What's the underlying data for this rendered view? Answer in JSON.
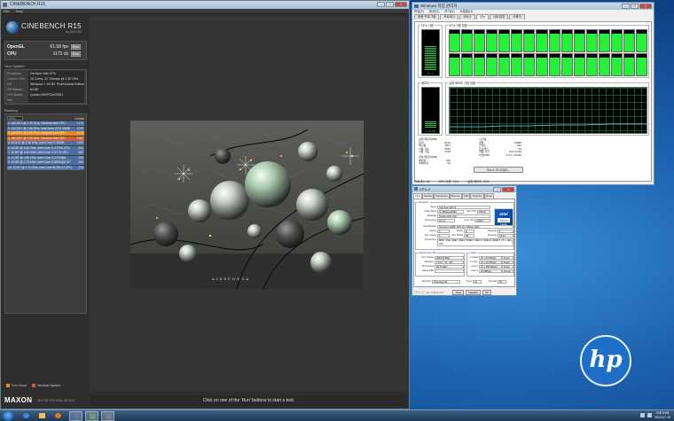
{
  "cinebench": {
    "window_title": "CINEBENCH R15",
    "menu": [
      "File",
      "Help"
    ],
    "app_name": "CINEBENCH R15",
    "app_sub": "by MAXON",
    "results": [
      {
        "label": "OpenGL",
        "value": "61.58 fps",
        "button": "Run"
      },
      {
        "label": "CPU",
        "value": "1173 cb",
        "button": "Run"
      }
    ],
    "system_heading": "Your System",
    "system": [
      {
        "k": "Processor",
        "v": "Genuine Intel CPU"
      },
      {
        "k": "Cores x GHz",
        "v": "16 Cores, 32 Threads @ 2.30 GHz"
      },
      {
        "k": "OS",
        "v": "Windows 7, 64 Bit, Professional Edition"
      },
      {
        "k": "CB Version",
        "v": "64 Bit"
      },
      {
        "k": "GFX Board",
        "v": "Quadro 600/PCIe/SSE2"
      },
      {
        "k": "Info",
        "v": ""
      }
    ],
    "ranking_heading": "Ranking",
    "ranking_select": "CPU",
    "ranking_details": "Details",
    "ranking": [
      {
        "t": "1. 16C/32T @ 2.30 GHz, Genuine Intel CPU",
        "s": "1173",
        "c": "#4c6f9f"
      },
      {
        "t": "2. 12C/24T @ 2.66 GHz, Intel Xeon CPU X5650",
        "s": "1279",
        "c": "#4c6f9f"
      },
      {
        "t": "3. 16C/32T @ 2.30 GHz, Genuine Intel CPU",
        "s": "1173",
        "c": "#e58a1e"
      },
      {
        "t": "4. 16C/32T @ 2.30 GHz, Genuine Intel CPU",
        "s": "1084",
        "c": "#c9632f"
      },
      {
        "t": "5. 6C/12T @ 3.30 GHz, Intel Core i7-3930K",
        "s": "1005",
        "c": "#4c6f9f"
      },
      {
        "t": "6. 4C/8T @ 4.40 GHz, Intel Core i7-4770K CPU",
        "s": "822",
        "c": "#4c6f9f"
      },
      {
        "t": "7. 4C/8T @ 3.40 GHz, Intel Core i7-3770 CPU",
        "s": "662",
        "c": "#4c6f9f"
      },
      {
        "t": "8. 4C/8T @ 2.60 GHz, Intel Core i7-3720QM",
        "s": "590",
        "c": "#4c6f9f"
      },
      {
        "t": "9. 4C/8T @ 2.79 GHz, Intel Core i7-3840QM CP",
        "s": "505",
        "c": "#4c6f9f"
      },
      {
        "t": "10. 2C/4T @ 1.70 GHz, Intel Core i5-3317U CPU",
        "s": "214",
        "c": "#4c6f9f"
      }
    ],
    "legend_your": "Your Score",
    "legend_identical": "Identical System",
    "maxon": "MAXON",
    "maxon_tag": "3D FOR THE REAL WORLD",
    "status": "Click on one of the 'Run' buttons to start a test.",
    "watermark": "AIXSPONZA"
  },
  "taskmgr": {
    "window_title": "Windows 작업 관리자",
    "menu": [
      "파일(F)",
      "옵션(O)",
      "보기(V)",
      "도움말(H)"
    ],
    "tabs": [
      "응용 프로그램",
      "프로세스",
      "서비스",
      "성능",
      "네트워킹",
      "사용자"
    ],
    "active_tab": 3,
    "cpu_usage_label": "CPU 사용",
    "cpu_usage_value": "61 %",
    "cpu_history_label": "CPU 사용 현황",
    "mem_label": "메모리",
    "mem_value": "1.57 GB",
    "mem_history_label": "실제 메모리 사용 현황",
    "physical_heading": "실제 메모리(MB)",
    "physical": [
      {
        "k": "합계",
        "v": "8132"
      },
      {
        "k": "캐시됨",
        "v": "1507"
      },
      {
        "k": "사용 가능",
        "v": "6525"
      },
      {
        "k": "사용 가능",
        "v": "5149"
      }
    ],
    "kernel_heading": "커널 메모리(MB)",
    "kernel": [
      {
        "k": "페이징",
        "v": "203"
      },
      {
        "k": "비페이징",
        "v": "62"
      }
    ],
    "system_heading": "시스템",
    "system": [
      {
        "k": "핸들",
        "v": "19586"
      },
      {
        "k": "스레드",
        "v": "922"
      },
      {
        "k": "프로세스",
        "v": "52"
      },
      {
        "k": "작동 시간",
        "v": "0:00:14:39"
      },
      {
        "k": "커밋(MB)",
        "v": "1717 / 16262"
      }
    ],
    "resmon_button": "리소스 모니터(R)...",
    "status": [
      "프로세스: 54",
      "CPU 사용: 74%",
      "실제 메모리: 20%"
    ]
  },
  "cpuz": {
    "window_title": "CPU-Z",
    "tabs": [
      "CPU",
      "Caches",
      "Mainboard",
      "Memory",
      "SPD",
      "Graphics",
      "About"
    ],
    "processor_heading": "Processor",
    "name_k": "Name",
    "name_v": "Intel Xeon E5 v3",
    "codename_k": "Code Name",
    "codename_v": "Ivy Bridge-EP/EX",
    "maxtdp_k": "Max TDP",
    "maxtdp_v": "105 W",
    "package_k": "Package",
    "package_v": "Socket 2011 LGA",
    "tech_k": "Technology",
    "tech_v": "22 nm",
    "voltage_k": "Core VID",
    "voltage_v": "0.908 V",
    "spec_k": "Specification",
    "spec_v": "Genuine Intel(R) CPU @ 2.30GHz (ES)",
    "family_k": "Family",
    "family_v": "6",
    "model_k": "Model",
    "model_v": "E",
    "stepping_k": "Stepping",
    "stepping_v": "4",
    "extfamily_k": "Ext. Family",
    "extfamily_v": "6",
    "extmodel_k": "Ext. Model",
    "extmodel_v": "3E",
    "revision_k": "Revision",
    "revision_v": "C1/L2",
    "instr_k": "Instructions",
    "instr_v": "MMX, SSE, SSE2, SSE3, SSSE3, SSE4.1, SSE4.2, EM64T, VT-x, AES, AVX",
    "clocks_heading": "Clocks (Core #0)",
    "corespeed_k": "Core Speed",
    "corespeed_v": "2094.59 MHz",
    "mult_k": "Multiplier",
    "mult_v": "x 21.0 ( 12 - 30 )",
    "bus_k": "Bus Speed",
    "bus_v": "99.74 MHz",
    "fsb_k": "Rated FSB",
    "fsb_v": "",
    "cache_heading": "Cache",
    "l1d_k": "L1 Data",
    "l1d_v": "16 x 32 KBytes",
    "l1d_w": "8-way",
    "l1i_k": "L1 Inst.",
    "l1i_v": "16 x 32 KBytes",
    "l1i_w": "8-way",
    "l2_k": "Level 2",
    "l2_v": "16 x 256 KBytes",
    "l2_w": "8-way",
    "l3_k": "Level 3",
    "l3_v": "25 MBytes",
    "l3_w": "20-way",
    "selection_k": "Selection",
    "selection_v": "Processor #1",
    "cores_k": "Cores",
    "cores_v": "16",
    "threads_k": "Threads",
    "threads_v": "32",
    "brand": "CPU-Z",
    "version": "Ver. 1.69.2.x64",
    "tools": "Tools",
    "validate": "Validate",
    "ok": "OK",
    "intel_a": "intel",
    "intel_b": "Xeon",
    "intel_c": "inside"
  },
  "hp_logo": "hp",
  "taskbar": {
    "time": "오후 8:58",
    "date": "2014-07-19"
  },
  "colors": {
    "cb_bg": "#2e2e2e",
    "rank_your": "#e58a1e",
    "rank_identical": "#c9632f",
    "graph_green": "#25f03a"
  }
}
